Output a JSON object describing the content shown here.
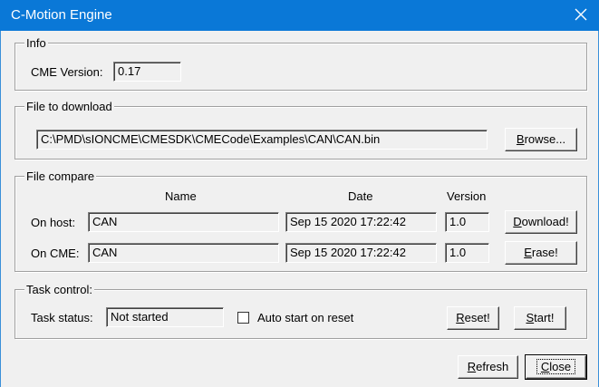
{
  "window": {
    "title": "C-Motion Engine"
  },
  "info": {
    "legend": "Info",
    "cme_version_label": "CME Version:",
    "cme_version_value": "0.17"
  },
  "file_download": {
    "legend": "File to download",
    "path": "C:\\PMD\\sIONCME\\CMESDK\\CMECode\\Examples\\CAN\\CAN.bin",
    "browse_label": "Browse..."
  },
  "file_compare": {
    "legend": "File compare",
    "headers": {
      "name": "Name",
      "date": "Date",
      "version": "Version"
    },
    "host": {
      "label": "On host:",
      "name": "CAN",
      "date": "Sep 15 2020  17:22:42",
      "version": "1.0",
      "button": "Download!"
    },
    "cme": {
      "label": "On CME:",
      "name": "CAN",
      "date": "Sep 15 2020  17:22:42",
      "version": "1.0",
      "button": "Erase!"
    }
  },
  "task_control": {
    "legend": "Task control:",
    "status_label": "Task status:",
    "status_value": "Not started",
    "auto_start_label": "Auto start on reset",
    "auto_start_checked": false,
    "reset_label": "Reset!",
    "start_label": "Start!"
  },
  "footer": {
    "refresh_label": "Refresh",
    "close_label": "Close"
  }
}
